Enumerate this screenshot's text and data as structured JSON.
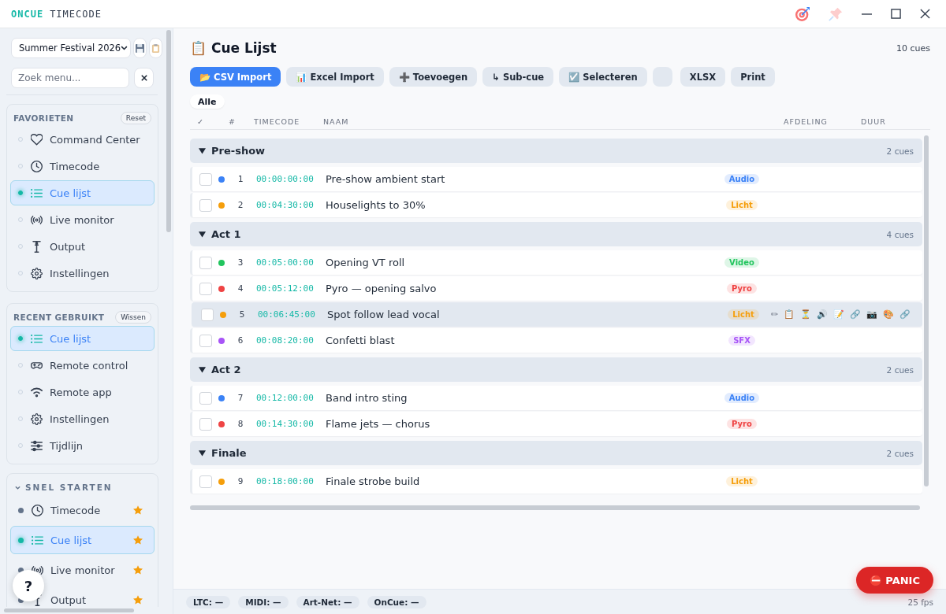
{
  "titlebar": {
    "brand": "ONCUE",
    "product": "TIMECODE",
    "pinned": false
  },
  "sidebar": {
    "project": "Summer Festival 2026",
    "search": {
      "placeholder": "Zoek menu..."
    },
    "sections": [
      {
        "kind": "list",
        "title": "FAVORIETEN",
        "action": "Reset",
        "items": [
          {
            "kind": "command",
            "label": "Command Center",
            "selected": false
          },
          {
            "kind": "timecode",
            "label": "Timecode",
            "selected": false
          },
          {
            "kind": "cuelist",
            "label": "Cue lijst",
            "selected": true
          },
          {
            "kind": "monitor",
            "label": "Live monitor",
            "selected": false
          },
          {
            "kind": "output",
            "label": "Output",
            "selected": false
          },
          {
            "kind": "settings",
            "label": "Instellingen",
            "selected": false
          }
        ]
      },
      {
        "kind": "list",
        "title": "RECENT GEBRUIKT",
        "action": "Wissen",
        "items": [
          {
            "kind": "cuelist",
            "label": "Cue lijst",
            "selected": true
          },
          {
            "kind": "remote",
            "label": "Remote control",
            "selected": false
          },
          {
            "kind": "app",
            "label": "Remote app",
            "selected": false
          },
          {
            "kind": "settings",
            "label": "Instellingen",
            "selected": false
          },
          {
            "kind": "timeline",
            "label": "Tijdlijn",
            "selected": false
          }
        ]
      },
      {
        "kind": "quick",
        "title": "SNEL STARTEN",
        "expanded": true,
        "items": [
          {
            "kind": "timecode",
            "label": "Timecode",
            "selected": false,
            "starred": true
          },
          {
            "kind": "cuelist",
            "label": "Cue lijst",
            "selected": true,
            "starred": true
          },
          {
            "kind": "monitor",
            "label": "Live monitor",
            "selected": false,
            "starred": true
          },
          {
            "kind": "output",
            "label": "Output",
            "selected": false,
            "starred": true
          }
        ]
      }
    ]
  },
  "main": {
    "title": "📋 Cue Lijst",
    "count": "10 cues",
    "toolbar": [
      {
        "kind": "primary",
        "label": "📂 CSV Import"
      },
      {
        "kind": "default",
        "label": "📊 Excel Import"
      },
      {
        "kind": "default",
        "label": "➕ Toevoegen"
      },
      {
        "kind": "default",
        "label": "↳ Sub-cue"
      },
      {
        "kind": "default",
        "label": "☑️ Selecteren"
      },
      {
        "kind": "blank"
      },
      {
        "kind": "default",
        "label": "XLSX"
      },
      {
        "kind": "default",
        "label": "Print"
      }
    ],
    "filters": [
      {
        "label": "Alle",
        "selected": true
      }
    ],
    "columns": [
      "✓",
      "#",
      "TIMECODE",
      "NAAM",
      "AFDELING",
      "DUUR"
    ],
    "groups": [
      {
        "name": "Pre-show",
        "count": "2 cues",
        "expanded": true,
        "rows": [
          {
            "number": "1",
            "timecode": "00:00:00:00",
            "name": "Pre-show ambient start",
            "department": "Audio",
            "color": "#3b82f6",
            "checked": false,
            "selected": false
          },
          {
            "number": "2",
            "timecode": "00:04:30:00",
            "name": "Houselights to 30%",
            "department": "Licht",
            "color": "#f59e0b",
            "checked": false,
            "selected": false
          }
        ]
      },
      {
        "name": "Act 1",
        "count": "4 cues",
        "expanded": true,
        "rows": [
          {
            "number": "3",
            "timecode": "00:05:00:00",
            "name": "Opening VT roll",
            "department": "Video",
            "color": "#22c55e",
            "checked": false,
            "selected": false
          },
          {
            "number": "4",
            "timecode": "00:05:12:00",
            "name": "Pyro — opening salvo",
            "department": "Pyro",
            "color": "#ef4444",
            "checked": false,
            "selected": false
          },
          {
            "number": "5",
            "timecode": "00:06:45:00",
            "name": "Spot follow lead vocal",
            "department": "Licht",
            "color": "#f59e0b",
            "checked": false,
            "selected": true,
            "actions": [
              "✏",
              "📋",
              "⏳",
              "🔊",
              "📝",
              "🔗",
              "📷",
              "🎨",
              "🔗"
            ]
          },
          {
            "number": "6",
            "timecode": "00:08:20:00",
            "name": "Confetti blast",
            "department": "SFX",
            "color": "#a855f7",
            "checked": false,
            "selected": false
          }
        ]
      },
      {
        "name": "Act 2",
        "count": "2 cues",
        "expanded": true,
        "rows": [
          {
            "number": "7",
            "timecode": "00:12:00:00",
            "name": "Band intro sting",
            "department": "Audio",
            "color": "#3b82f6",
            "checked": false,
            "selected": false
          },
          {
            "number": "8",
            "timecode": "00:14:30:00",
            "name": "Flame jets — chorus",
            "department": "Pyro",
            "color": "#ef4444",
            "checked": false,
            "selected": false
          }
        ]
      },
      {
        "name": "Finale",
        "count": "2 cues",
        "expanded": true,
        "rows": [
          {
            "number": "9",
            "timecode": "00:18:00:00",
            "name": "Finale strobe build",
            "department": "Licht",
            "color": "#f59e0b",
            "checked": false,
            "selected": false
          }
        ]
      }
    ]
  },
  "status_bar": {
    "items": [
      "LTC: —",
      "MIDI: —",
      "Art-Net: —",
      "OnCue: —"
    ],
    "fps": "25 fps"
  },
  "help_button": {
    "label": "?"
  },
  "panic_button": {
    "label": "⛔ PANIC"
  }
}
